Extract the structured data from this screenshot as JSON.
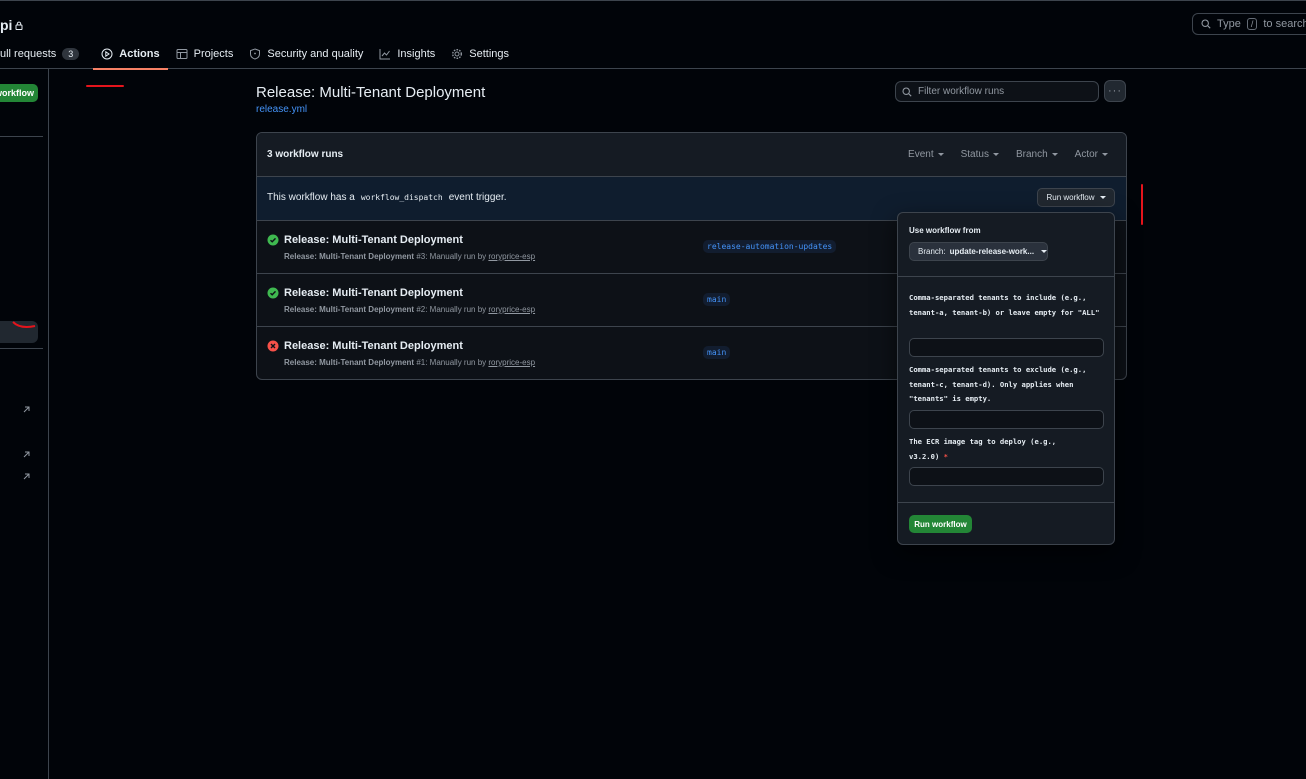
{
  "repo": {
    "name": "pi"
  },
  "search": {
    "prefix": "Type",
    "key": "/",
    "suffix": "to search"
  },
  "nav": {
    "pull_requests": {
      "label": "ull requests",
      "count": "3"
    },
    "actions": "Actions",
    "projects": "Projects",
    "security": "Security and quality",
    "insights": "Insights",
    "settings": "Settings"
  },
  "sidebar": {
    "new_workflow_label": "workflow"
  },
  "workflow": {
    "title": "Release: Multi-Tenant Deployment",
    "file": "release.yml",
    "filter_placeholder": "Filter workflow runs",
    "more_label": "···"
  },
  "runs_header": {
    "count_label": "3 workflow runs",
    "filters": [
      "Event",
      "Status",
      "Branch",
      "Actor"
    ]
  },
  "trigger": {
    "prefix": "This workflow has a",
    "code": "workflow_dispatch",
    "suffix": "event trigger.",
    "button": "Run workflow"
  },
  "runs": [
    {
      "title": "Release: Multi-Tenant Deployment",
      "workflow": "Release: Multi-Tenant Deployment",
      "number": "#3",
      "detail": ": Manually run by",
      "actor": "roryprice-esp",
      "branch": "release-automation-updates",
      "status": "success"
    },
    {
      "title": "Release: Multi-Tenant Deployment",
      "workflow": "Release: Multi-Tenant Deployment",
      "number": "#2",
      "detail": ": Manually run by",
      "actor": "roryprice-esp",
      "branch": "main",
      "status": "success"
    },
    {
      "title": "Release: Multi-Tenant Deployment",
      "workflow": "Release: Multi-Tenant Deployment",
      "number": "#1",
      "detail": ": Manually run by",
      "actor": "roryprice-esp",
      "branch": "main",
      "status": "failure"
    }
  ],
  "dispatch_panel": {
    "use_from": "Use workflow from",
    "branch_prefix": "Branch:",
    "branch_value": "update-release-work...",
    "inputs": [
      {
        "label": "Comma-separated tenants to include (e.g., tenant-a, tenant-b) or leave empty for \"ALL\"",
        "value": "",
        "required": false
      },
      {
        "label": "Comma-separated tenants to exclude (e.g., tenant-c, tenant-d). Only applies when \"tenants\" is empty.",
        "value": "",
        "required": false
      },
      {
        "label": "The ECR image tag to deploy (e.g., v3.2.0)",
        "value": "",
        "required": true
      }
    ],
    "required_mark": "*",
    "submit": "Run workflow"
  },
  "colors": {
    "background": "#010409",
    "panel": "#151b23",
    "border": "#3d444d",
    "accent_green": "#238636",
    "link_blue": "#4493f8",
    "success": "#3fb950",
    "failure": "#f85149",
    "annotation_red": "#e5141c"
  },
  "icons": [
    "lock-icon",
    "search-icon",
    "play-icon",
    "table-icon",
    "shield-icon",
    "graph-icon",
    "gear-icon",
    "kebab-icon",
    "check-circle-icon",
    "x-circle-icon",
    "arrow-up-right-icon",
    "caret-down-icon"
  ]
}
